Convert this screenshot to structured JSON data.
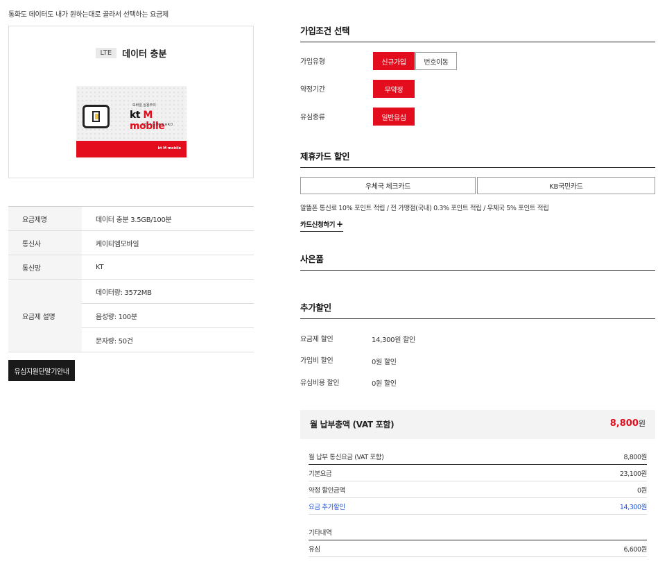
{
  "tagline": "통화도 데이터도 내가 원하는대로 골라서 선택하는 요금제",
  "product": {
    "badge": "LTE",
    "name": "데이터 충분",
    "usim": {
      "sub": "모바일 실용주의",
      "brand_kt": "kt",
      "brand_m": "M mobile",
      "card": "LTE USIM CARD",
      "band_logo": "kt M mobile"
    }
  },
  "spec": {
    "rows": [
      {
        "k": "요금제명",
        "v": "데이터 충분 3.5GB/100분"
      },
      {
        "k": "통신사",
        "v": "케이티엠모바일"
      },
      {
        "k": "통신망",
        "v": "KT"
      }
    ],
    "desc_label": "요금제 설명",
    "desc_values": [
      "데이터량: 3572MB",
      "음성량: 100분",
      "문자량: 50건"
    ]
  },
  "guide_button": "유심지원단말기안내",
  "join": {
    "title": "가입조건 선택",
    "type_label": "가입유형",
    "type_options": [
      "신규가입",
      "번호이동"
    ],
    "term_label": "약정기간",
    "term_option": "무약정",
    "usim_label": "유심종류",
    "usim_option": "일반유심"
  },
  "cards": {
    "title": "제휴카드 할인",
    "options": [
      "우체국 체크카드",
      "KB국민카드"
    ],
    "desc": "알뜰폰 통신료 10% 포인트 적립 / 전 가맹점(국내) 0.3% 포인트 적립 / 우체국 5% 포인트 적립",
    "apply": "카드신청하기",
    "apply_icon": "+"
  },
  "gift": {
    "title": "사은품"
  },
  "extra": {
    "title": "추가할인",
    "rows": [
      {
        "k": "요금제 할인",
        "v": "14,300원 할인"
      },
      {
        "k": "가입비 할인",
        "v": "0원 할인"
      },
      {
        "k": "유심비용 할인",
        "v": "0원 할인"
      }
    ]
  },
  "total": {
    "label": "월 납부총액 (VAT 포함)",
    "value": "8,800",
    "unit": "원"
  },
  "breakdown": [
    {
      "l": "월 납부 통신요금 (VAT 포함)",
      "r": "8,800원"
    },
    {
      "l": "기본요금",
      "r": "23,100원"
    },
    {
      "l": "약정 할인금액",
      "r": "0원"
    },
    {
      "l": "요금 추가할인",
      "r": "14,300원"
    }
  ],
  "etc": {
    "title": "기타내역",
    "rows": [
      {
        "l": "유심",
        "r": "6,600원"
      }
    ]
  },
  "colors": {
    "accent": "#e30d1d",
    "link_blue": "#2156d6"
  }
}
